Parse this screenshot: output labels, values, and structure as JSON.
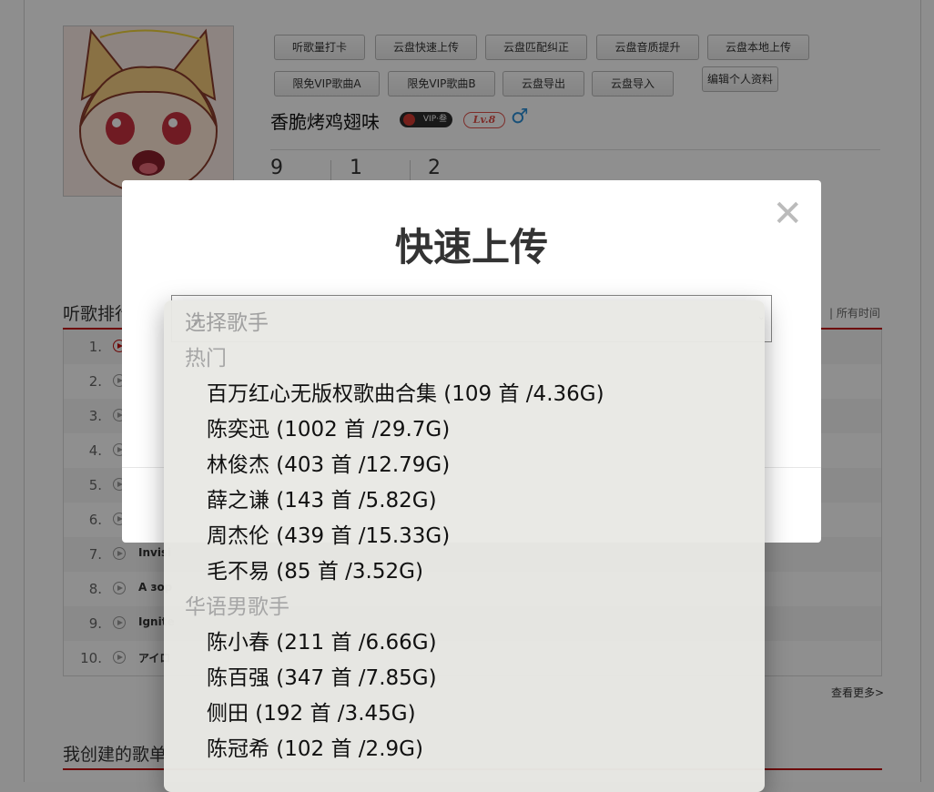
{
  "profile": {
    "username": "香脆烤鸡翅味",
    "vip_label": "VIP·叁",
    "level": "Lv.8",
    "gender_icon": "male-icon",
    "buttons": [
      "听歌量打卡",
      "云盘快速上传",
      "云盘匹配纠正",
      "云盘音质提升",
      "云盘本地上传",
      "限免VIP歌曲A",
      "限免VIP歌曲B",
      "云盘导出",
      "云盘导入",
      "编辑个人资料"
    ],
    "stats": [
      "9",
      "1",
      "2"
    ]
  },
  "ranking": {
    "title": "听歌排行",
    "tab_all": "所有时间",
    "more": "查看更多>",
    "rows": [
      {
        "num": "1.",
        "song": ""
      },
      {
        "num": "2.",
        "song": ""
      },
      {
        "num": "3.",
        "song": ""
      },
      {
        "num": "4.",
        "song": ""
      },
      {
        "num": "5.",
        "song": ""
      },
      {
        "num": "6.",
        "song": ""
      },
      {
        "num": "7.",
        "song": "Invisi"
      },
      {
        "num": "8.",
        "song": "A зор"
      },
      {
        "num": "9.",
        "song": "Ignite"
      },
      {
        "num": "10.",
        "song": "アイロ"
      }
    ]
  },
  "created_title": "我创建的歌单",
  "modal": {
    "title": "快速上传",
    "close_icon": "close-icon"
  },
  "dropdown": {
    "selected": "选择歌手",
    "groups": [
      {
        "label": "热门",
        "items": [
          "百万红心无版权歌曲合集 (109 首 /4.36G)",
          "陈奕迅 (1002 首 /29.7G)",
          "林俊杰 (403 首 /12.79G)",
          "薛之谦 (143 首 /5.82G)",
          "周杰伦 (439 首 /15.33G)",
          "毛不易 (85 首 /3.52G)"
        ]
      },
      {
        "label": "华语男歌手",
        "items": [
          "陈小春 (211 首 /6.66G)",
          "陈百强 (347 首 /7.85G)",
          "侧田 (192 首 /3.45G)",
          "陈冠希 (102 首 /2.9G)"
        ]
      }
    ]
  }
}
